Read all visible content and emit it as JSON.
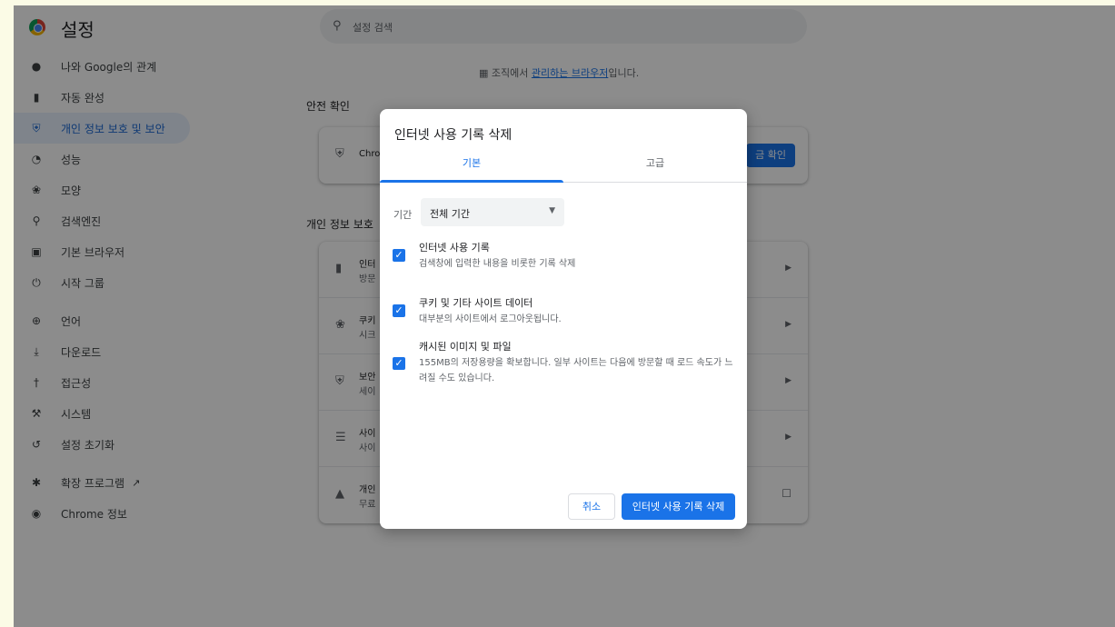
{
  "header": {
    "title": "설정",
    "search_placeholder": "설정 검색"
  },
  "sidebar": {
    "items": [
      {
        "label": "나와 Google의 관계",
        "icon": "person-icon"
      },
      {
        "label": "자동 완성",
        "icon": "clipboard-icon"
      },
      {
        "label": "개인 정보 보호 및 보안",
        "icon": "shield-icon"
      },
      {
        "label": "성능",
        "icon": "speedometer-icon"
      },
      {
        "label": "모양",
        "icon": "palette-icon"
      },
      {
        "label": "검색엔진",
        "icon": "search-icon"
      },
      {
        "label": "기본 브라우저",
        "icon": "browser-icon"
      },
      {
        "label": "시작 그룹",
        "icon": "power-icon"
      },
      {
        "label": "언어",
        "icon": "globe-icon"
      },
      {
        "label": "다운로드",
        "icon": "download-icon"
      },
      {
        "label": "접근성",
        "icon": "accessibility-icon"
      },
      {
        "label": "시스템",
        "icon": "wrench-icon"
      },
      {
        "label": "설정 초기화",
        "icon": "reset-icon"
      },
      {
        "label": "확장 프로그램",
        "icon": "puzzle-icon"
      },
      {
        "label": "Chrome 정보",
        "icon": "chrome-icon"
      }
    ]
  },
  "main": {
    "managed_prefix": "조직에서 ",
    "managed_link": "관리하는 브라우저",
    "managed_suffix": "입니다.",
    "safety_heading": "안전 확인",
    "safety_text": "Chro",
    "safety_button": "금 확인",
    "privacy_heading": "개인 정보 보호",
    "rows": [
      {
        "t1": "인터",
        "t2": "방문"
      },
      {
        "t1": "쿠키",
        "t2": "시크"
      },
      {
        "t1": "보안",
        "t2": "세이"
      },
      {
        "t1": "사이",
        "t2": "사이"
      },
      {
        "t1": "개인",
        "t2": "무료"
      }
    ]
  },
  "dialog": {
    "title": "인터넷 사용 기록 삭제",
    "tabs": [
      "기본",
      "고급"
    ],
    "range_label": "기간",
    "range_value": "전체 기간",
    "options": [
      {
        "title": "인터넷 사용 기록",
        "desc": "검색창에 입력한 내용을 비롯한 기록 삭제",
        "checked": true
      },
      {
        "title": "쿠키 및 기타 사이트 데이터",
        "desc": "대부분의 사이트에서 로그아웃됩니다.",
        "checked": true
      },
      {
        "title": "캐시된 이미지 및 파일",
        "desc": "155MB의 저장용량을 확보합니다. 일부 사이트는 다음에 방문할 때 로드 속도가 느려질 수도 있습니다.",
        "checked": true
      }
    ],
    "cancel_label": "취소",
    "delete_label": "인터넷 사용 기록 삭제"
  },
  "colors": {
    "accent": "#1a73e8",
    "overlay": "rgba(0,0,0,0.45)"
  }
}
